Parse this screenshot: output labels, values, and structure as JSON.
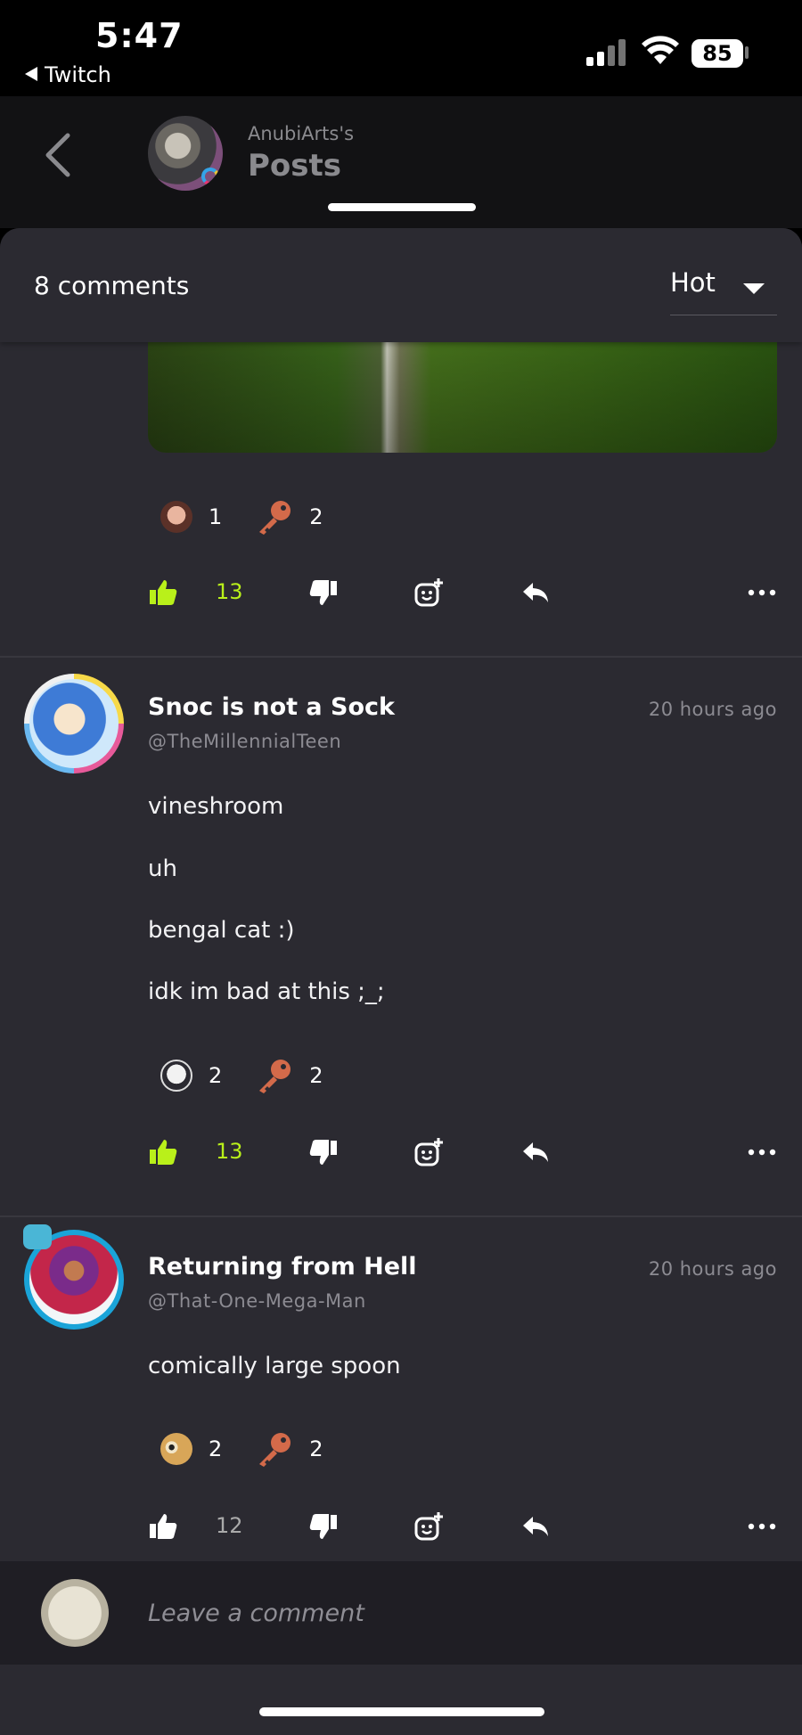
{
  "status_bar": {
    "time": "5:47",
    "back_app": "Twitch",
    "battery": "85"
  },
  "header": {
    "owner": "AnubiArts's",
    "title": "Posts"
  },
  "comments_bar": {
    "count_label": "8 comments",
    "sort_selected": "Hot"
  },
  "top_post": {
    "reactions": [
      {
        "icon": "face-emoji-icon",
        "count": "1"
      },
      {
        "icon": "key-emoji-icon",
        "count": "2"
      }
    ],
    "likes": "13",
    "liked": true
  },
  "comments": [
    {
      "author": "Snoc is not a Sock",
      "handle": "@TheMillennialTeen",
      "time": "20 hours ago",
      "lines": [
        "vineshroom",
        "uh",
        "bengal cat :)",
        "idk im bad at this ;_;"
      ],
      "reactions": [
        {
          "icon": "ghost-emoji-icon",
          "count": "2"
        },
        {
          "icon": "key-emoji-icon",
          "count": "2"
        }
      ],
      "likes": "13",
      "liked": true
    },
    {
      "author": "Returning from Hell",
      "handle": "@That-One-Mega-Man",
      "time": "20 hours ago",
      "lines": [
        "comically large spoon"
      ],
      "reactions": [
        {
          "icon": "owl-emoji-icon",
          "count": "2"
        },
        {
          "icon": "key-emoji-icon",
          "count": "2"
        }
      ],
      "likes": "12",
      "liked": false
    }
  ],
  "composer": {
    "placeholder": "Leave a comment"
  },
  "colors": {
    "like_active": "#b9f01a",
    "key": "#d36a4a",
    "sheet_bg": "#2b2a31"
  }
}
